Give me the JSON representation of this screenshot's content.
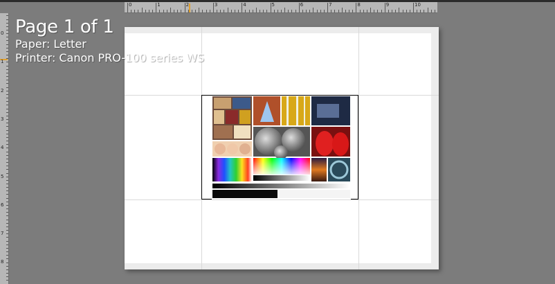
{
  "overlay": {
    "page_count": "Page 1 of 1",
    "paper_label": "Paper:",
    "paper_value": "Letter",
    "printer_label": "Printer:",
    "printer_value": "Canon PRO-100 series WS"
  },
  "rulers": {
    "horizontal_numbers": [
      "0",
      "1",
      "2",
      "3",
      "4",
      "5",
      "6",
      "7",
      "8",
      "9",
      "10"
    ],
    "vertical_numbers": [
      "0",
      "1",
      "2",
      "3",
      "4",
      "5",
      "6",
      "7",
      "8"
    ]
  },
  "colors": {
    "workspace": "#7c7c7c",
    "ruler": "#b7b7b7",
    "ruler_marker": "#e0a030",
    "page": "#ffffff"
  }
}
